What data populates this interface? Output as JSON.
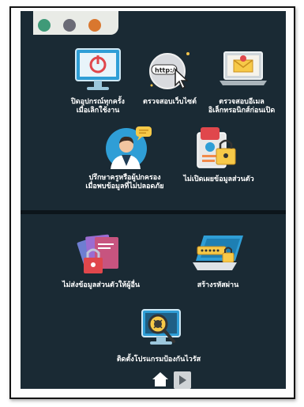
{
  "app": {
    "accent": "#2f9ed6",
    "background": "#1a2a34"
  },
  "tiles": [
    {
      "label": "ปิดอุปกรณ์ทุกครั้ง\nเมื่อเลิกใช้งาน",
      "icon": "monitor-power-icon"
    },
    {
      "label": "ตรวจสอบเว็บไซต์",
      "icon": "browser-cursor-icon",
      "url_text": "http://"
    },
    {
      "label": "ตรวจสอบอีเมล\nอิเล็กทรอนิกส์ก่อนเปิด",
      "icon": "laptop-mail-icon"
    },
    {
      "label": "ปรึกษาครูหรือผู้ปกครอง\nเมื่อพบข้อมูลที่ไม่ปลอดภัย",
      "icon": "advisor-speech-icon"
    },
    {
      "label": "ไม่เปิดเผยข้อมูลส่วนตัว",
      "icon": "id-card-lock-icon"
    },
    {
      "label": "ไม่ส่งข้อมูลส่วนตัวให้ผู้อื่น",
      "icon": "documents-lock-icon"
    },
    {
      "label": "สร้างรหัสผ่าน",
      "icon": "laptop-password-icon"
    },
    {
      "label": "ติดตั้งโปรแกรมป้องกันไวรัส",
      "icon": "virus-scan-icon"
    }
  ],
  "nav": {
    "home_icon": "home-icon",
    "next_icon": "play-next-icon"
  }
}
